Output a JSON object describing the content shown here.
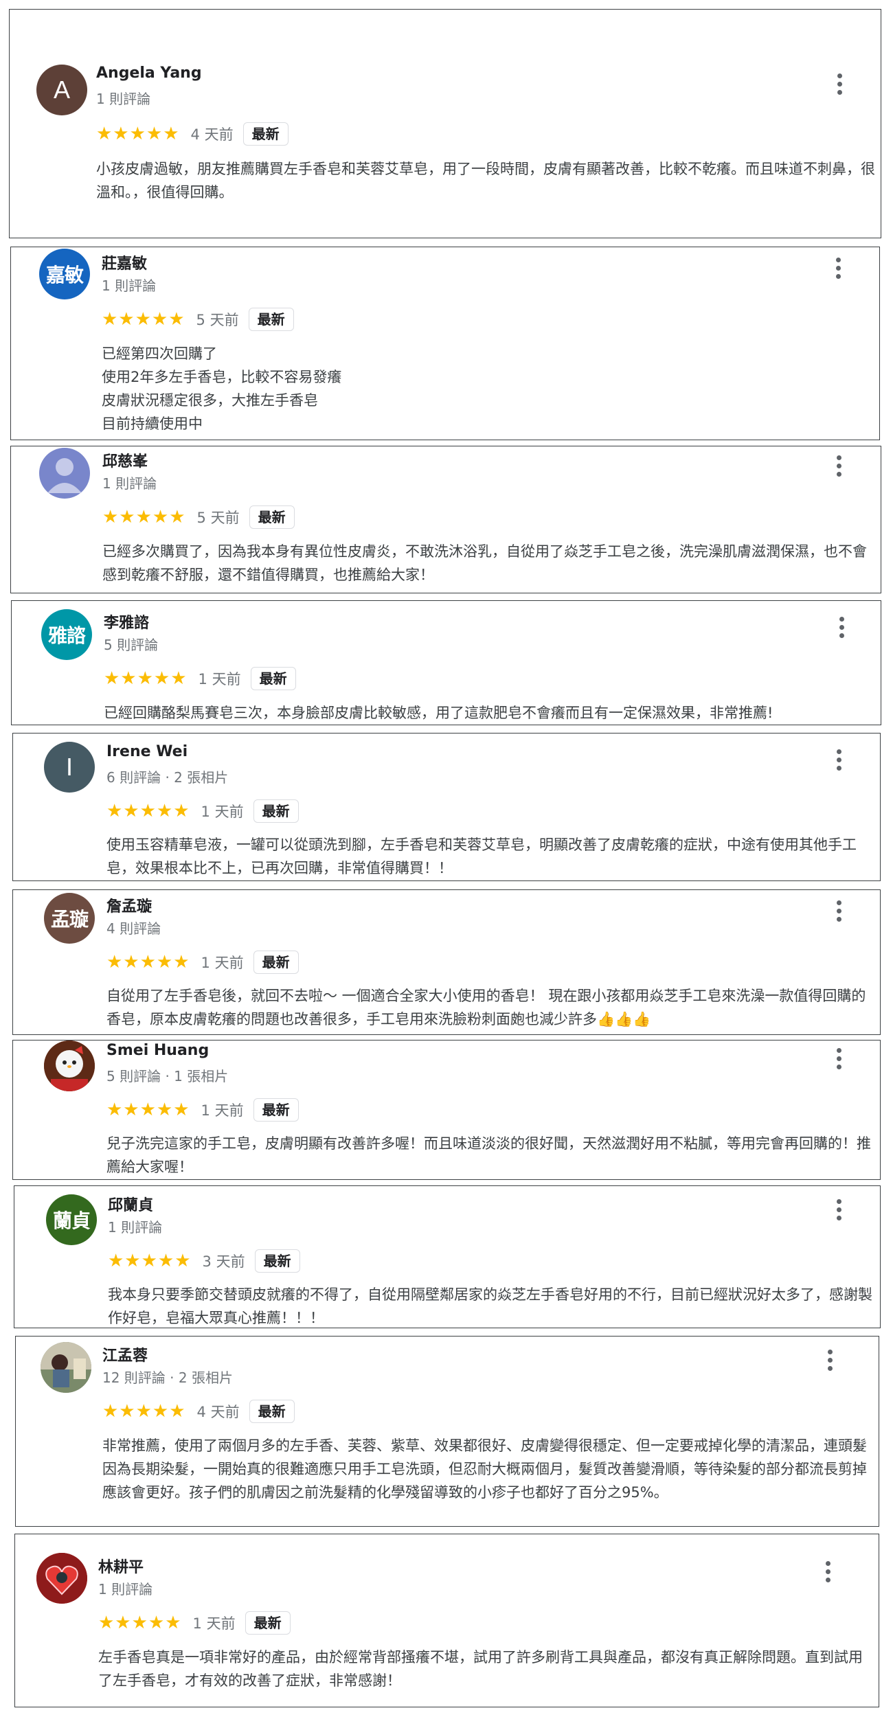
{
  "badge_label": "最新",
  "stars_text": "★★★★★",
  "reviews": [
    {
      "name": "Angela Yang",
      "meta": "1 則評論",
      "date": "4 天前",
      "text": "小孩皮膚過敏，朋友推薦購買左手香皂和芙蓉艾草皂，用了一段時間，皮膚有顯著改善，比較不乾癢。而且味道不刺鼻，很溫和。，很值得回購。",
      "avatar": {
        "type": "letter",
        "glyph": "A",
        "bg": "#5d4037"
      }
    },
    {
      "name": "莊嘉敏",
      "meta": "1 則評論",
      "date": "5 天前",
      "text": "已經第四次回購了\n使用2年多左手香皂，比較不容易發癢\n皮膚狀況穩定很多，大推左手香皂\n目前持續使用中",
      "avatar": {
        "type": "text",
        "glyph": "嘉敏",
        "bg": "#1565c0"
      }
    },
    {
      "name": "邱慈峯",
      "meta": "1 則評論",
      "date": "5 天前",
      "text": "已經多次購買了，因為我本身有異位性皮膚炎，不敢洗沐浴乳，自從用了焱芝手工皂之後，洗完澡肌膚滋潤保濕，也不會感到乾癢不舒服，還不錯值得購買，也推薦給大家！",
      "avatar": {
        "type": "person",
        "glyph": "",
        "bg": "#7986cb"
      }
    },
    {
      "name": "李雅諮",
      "meta": "5 則評論",
      "date": "1 天前",
      "text": "已經回購酪梨馬賽皂三次，本身臉部皮膚比較敏感，用了這款肥皂不會癢而且有一定保濕效果，非常推薦!",
      "avatar": {
        "type": "text",
        "glyph": "雅諮",
        "bg": "#0097a7"
      }
    },
    {
      "name": "Irene Wei",
      "meta": "6 則評論 · 2 張相片",
      "date": "1 天前",
      "text": "使用玉容精華皂液，一罐可以從頭洗到腳，左手香皂和芙蓉艾草皂，明顯改善了皮膚乾癢的症狀，中途有使用其他手工皂，效果根本比不上，已再次回購，非常值得購買！！",
      "avatar": {
        "type": "letter",
        "glyph": "I",
        "bg": "#455a64"
      }
    },
    {
      "name": "詹孟璇",
      "meta": "4 則評論",
      "date": "1 天前",
      "text": "自從用了左手香皂後，就回不去啦～ 一個適合全家大小使用的香皂！ 現在跟小孩都用焱芝手工皂來洗澡一款值得回購的香皂，原本皮膚乾癢的問題也改善很多，手工皂用來洗臉粉刺面皰也減少許多👍👍👍",
      "avatar": {
        "type": "text",
        "glyph": "孟璇",
        "bg": "#6d4c41"
      }
    },
    {
      "name": "Smei Huang",
      "meta": "5 則評論 · 1 張相片",
      "date": "1 天前",
      "text": "兒子洗完這家的手工皂，皮膚明顯有改善許多喔！而且味道淡淡的很好聞，天然滋潤好用不粘膩，等用完會再回購的！推薦給大家喔！",
      "avatar": {
        "type": "photo",
        "glyph": "",
        "bg": "#8d3a1e"
      }
    },
    {
      "name": "邱蘭貞",
      "meta": "1 則評論",
      "date": "3 天前",
      "text": "我本身只要季節交替頭皮就癢的不得了，自從用隔壁鄰居家的焱芝左手香皂好用的不行，目前已經狀況好太多了，感謝製作好皂，皂福大眾真心推薦！！！",
      "avatar": {
        "type": "text",
        "glyph": "蘭貞",
        "bg": "#33691e"
      }
    },
    {
      "name": "江孟蓉",
      "meta": "12 則評論 · 2 張相片",
      "date": "4 天前",
      "text": "非常推薦，使用了兩個月多的左手香、芙蓉、紫草、效果都很好、皮膚變得很穩定、但一定要戒掉化學的清潔品，連頭髮因為長期染髮，一開始真的很難適應只用手工皂洗頭，但忍耐大概兩個月，髮質改善變滑順，等待染髮的部分都流長剪掉應該會更好。孩子們的肌膚因之前洗髮精的化學殘留導致的小疹子也都好了百分之95%。",
      "avatar": {
        "type": "photo2",
        "glyph": "",
        "bg": "#6b7b5e"
      }
    },
    {
      "name": "林耕平",
      "meta": "1 則評論",
      "date": "1 天前",
      "text": "左手香皂真是一項非常好的產品，由於經常背部搔癢不堪，試用了許多刷背工具與產品，都沒有真正解除問題。直到試用了左手香皂，才有效的改善了症狀，非常感謝！",
      "avatar": {
        "type": "photo3",
        "glyph": "",
        "bg": "#b71c1c"
      }
    }
  ]
}
